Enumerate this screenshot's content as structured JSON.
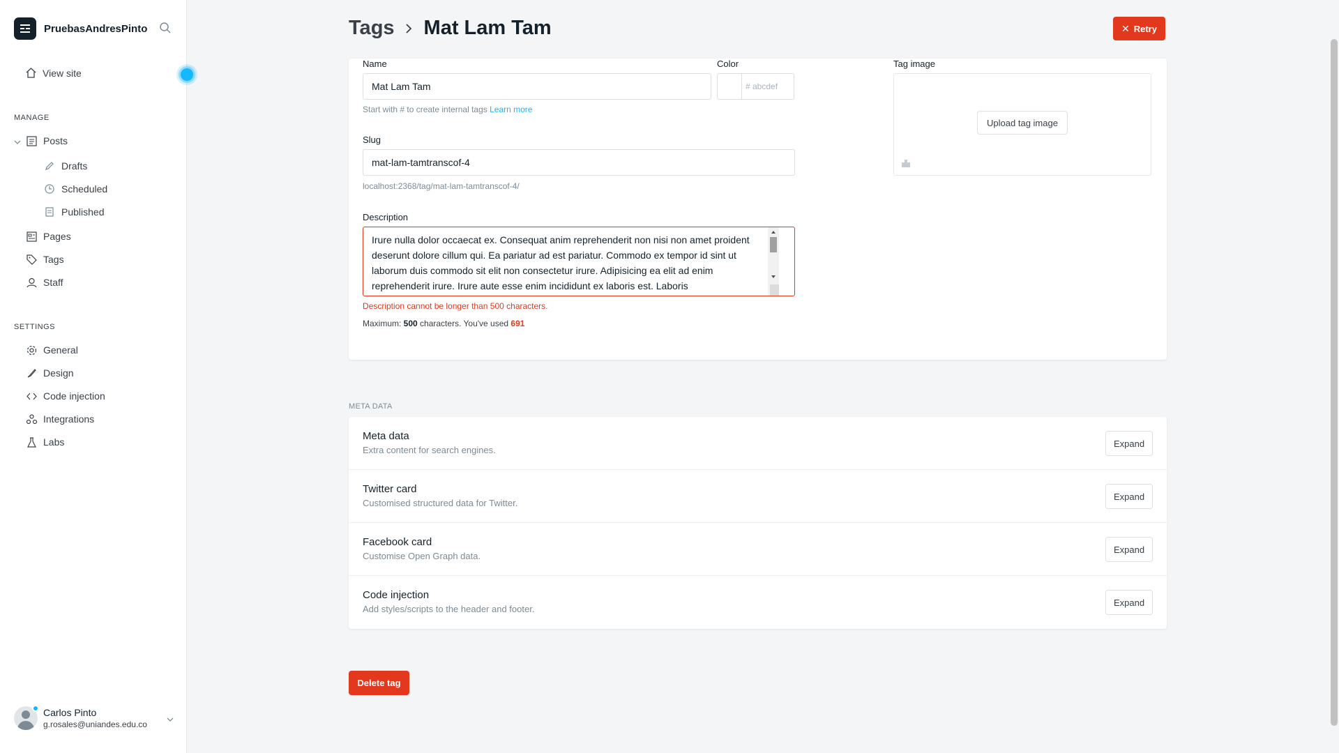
{
  "brand": {
    "name": "PruebasAndresPinto"
  },
  "sidebar": {
    "view_site": "View site",
    "manage_label": "MANAGE",
    "settings_label": "SETTINGS",
    "posts": "Posts",
    "drafts": "Drafts",
    "scheduled": "Scheduled",
    "published": "Published",
    "pages": "Pages",
    "tags": "Tags",
    "staff": "Staff",
    "general": "General",
    "design": "Design",
    "code_injection": "Code injection",
    "integrations": "Integrations",
    "labs": "Labs"
  },
  "user": {
    "name": "Carlos Pinto",
    "email": "g.rosales@uniandes.edu.co"
  },
  "header": {
    "crumb": "Tags",
    "current": "Mat Lam Tam",
    "retry": "Retry"
  },
  "form": {
    "name_label": "Name",
    "name_value": "Mat Lam Tam",
    "color_label": "Color",
    "color_placeholder": "# abcdef",
    "name_hint": "Start with # to create internal tags",
    "learn_more": "Learn more",
    "slug_label": "Slug",
    "slug_value": "mat-lam-tamtranscof-4",
    "slug_url": "localhost:2368/tag/mat-lam-tamtranscof-4/",
    "description_label": "Description",
    "description_value": "Irure nulla dolor occaecat ex. Consequat anim reprehenderit non nisi non amet proident deserunt dolore cillum qui. Ea pariatur ad est pariatur. Commodo ex tempor id sint ut laborum duis commodo sit elit non consectetur irure. Adipisicing ea elit ad enim reprehenderit irure. Irure aute esse enim incididunt ex laboris est. Laboris",
    "description_error": "Description cannot be longer than 500 characters.",
    "max_prefix": "Maximum: ",
    "max_value": "500",
    "max_middle": " characters. You've used ",
    "used_value": "691",
    "tag_image_label": "Tag image",
    "upload_label": "Upload tag image"
  },
  "meta": {
    "section_label": "META DATA",
    "rows": [
      {
        "title": "Meta data",
        "desc": "Extra content for search engines.",
        "button": "Expand"
      },
      {
        "title": "Twitter card",
        "desc": "Customised structured data for Twitter.",
        "button": "Expand"
      },
      {
        "title": "Facebook card",
        "desc": "Customise Open Graph data.",
        "button": "Expand"
      },
      {
        "title": "Code injection",
        "desc": "Add styles/scripts to the header and footer.",
        "button": "Expand"
      }
    ]
  },
  "delete_label": "Delete tag",
  "colors": {
    "accent": "#e2391e",
    "link": "#14b8ff",
    "dark": "#15212a"
  }
}
